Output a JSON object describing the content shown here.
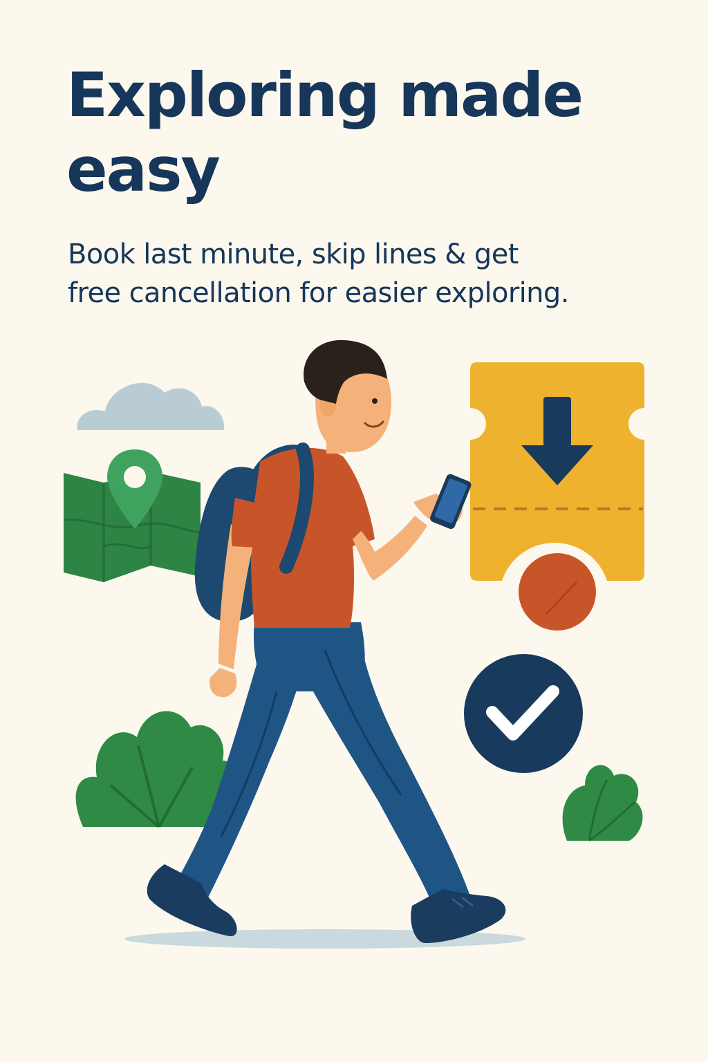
{
  "hero": {
    "title_line1": "Exploring made",
    "title_line2": "easy",
    "subtitle_line1": "Book last minute, skip lines & get",
    "subtitle_line2": "free cancellation for easier exploring."
  },
  "colors": {
    "background": "#FCF8EE",
    "text": "#16365A",
    "ticket": "#EEB22E",
    "shirt": "#C8552A",
    "pants": "#1F5585",
    "navy": "#183A5C",
    "green": "#2E8A45",
    "map_green": "#2D8444",
    "cloud": "#B9CCD4"
  },
  "icons": [
    "cloud-icon",
    "map-icon",
    "location-pin-icon",
    "ticket-icon",
    "download-arrow-icon",
    "cancel-badge-icon",
    "checkmark-icon",
    "bush-icon",
    "phone-icon"
  ]
}
